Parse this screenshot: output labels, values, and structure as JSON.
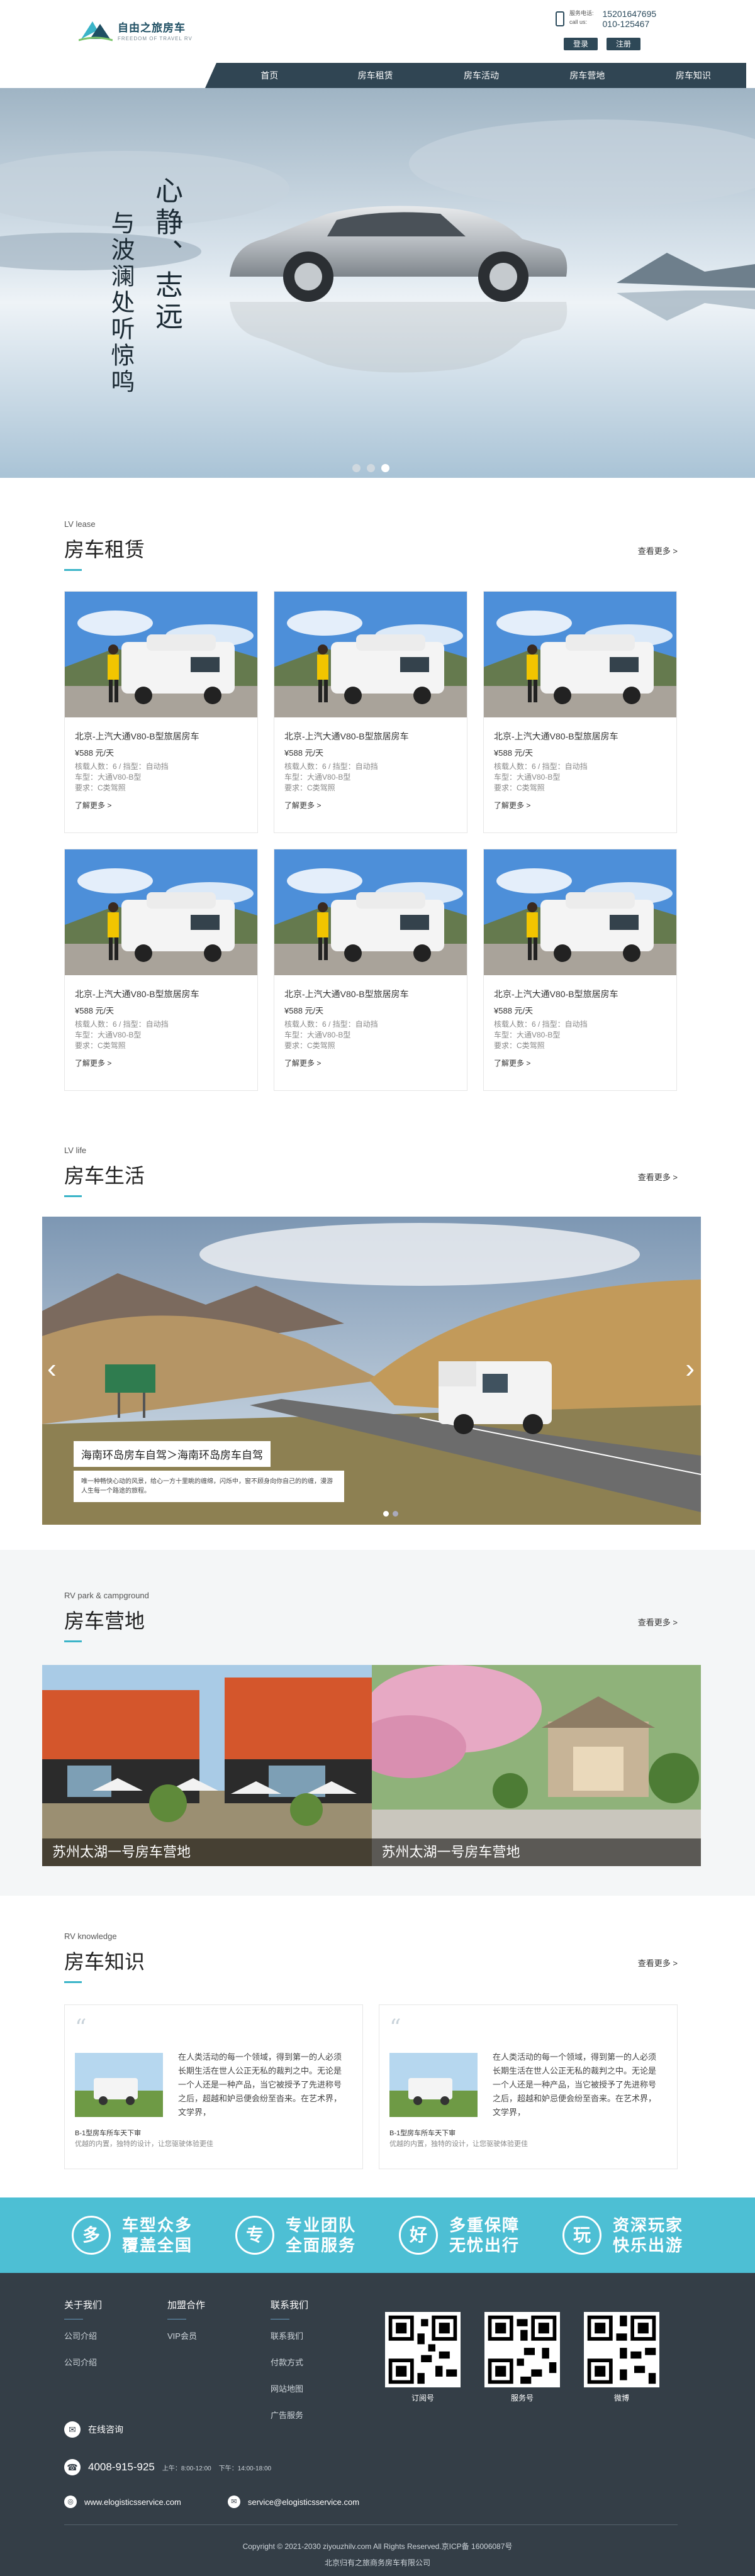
{
  "header": {
    "logo_cn": "自由之旅房车",
    "logo_en": "FREEDOM OF TRAVEL RV",
    "contact_label_1": "服务电话:",
    "contact_label_2": "call us:",
    "phone_1": "15201647695",
    "phone_2": "010-125467",
    "login_label": "登录",
    "register_label": "注册"
  },
  "nav": {
    "items": [
      "首页",
      "房车租赁",
      "房车活动",
      "房车营地",
      "房车知识"
    ]
  },
  "hero": {
    "line1": "心静、志远",
    "line2": "与波澜处听惊鸣",
    "slide_count": 3,
    "active_slide": 3
  },
  "lease": {
    "en": "LV lease",
    "cn": "房车租赁",
    "more": "查看更多 >",
    "cards": [
      {
        "title": "北京-上汽大通V80-B型旅居房车",
        "price": "¥588 元/天",
        "meta1": "核载人数：6 / 挡型：自动挡",
        "meta2": "车型：大通V80-B型",
        "meta3": "要求：C类驾照",
        "link": "了解更多 >"
      },
      {
        "title": "北京-上汽大通V80-B型旅居房车",
        "price": "¥588 元/天",
        "meta1": "核载人数：6 / 挡型：自动挡",
        "meta2": "车型：大通V80-B型",
        "meta3": "要求：C类驾照",
        "link": "了解更多 >"
      },
      {
        "title": "北京-上汽大通V80-B型旅居房车",
        "price": "¥588 元/天",
        "meta1": "核载人数：6 / 挡型：自动挡",
        "meta2": "车型：大通V80-B型",
        "meta3": "要求：C类驾照",
        "link": "了解更多 >"
      },
      {
        "title": "北京-上汽大通V80-B型旅居房车",
        "price": "¥588 元/天",
        "meta1": "核载人数：6 / 挡型：自动挡",
        "meta2": "车型：大通V80-B型",
        "meta3": "要求：C类驾照",
        "link": "了解更多 >"
      },
      {
        "title": "北京-上汽大通V80-B型旅居房车",
        "price": "¥588 元/天",
        "meta1": "核载人数：6 / 挡型：自动挡",
        "meta2": "车型：大通V80-B型",
        "meta3": "要求：C类驾照",
        "link": "了解更多 >"
      },
      {
        "title": "北京-上汽大通V80-B型旅居房车",
        "price": "¥588 元/天",
        "meta1": "核载人数：6 / 挡型：自动挡",
        "meta2": "车型：大通V80-B型",
        "meta3": "要求：C类驾照",
        "link": "了解更多 >"
      }
    ]
  },
  "life": {
    "en": "LV life",
    "cn": "房车生活",
    "more": "查看更多 >",
    "caption_title": "海南环岛房车自驾＞海南环岛房车自驾",
    "caption_desc": "唯一种畅快心动的风景，给心一方十里眺的缠绵，闪烁中，窗不顾身向你自己的的缠，漫游人生每一个路途的旅程。",
    "prev": "‹",
    "next": "›",
    "active_slide": 1
  },
  "camp": {
    "en": "RV park & campground",
    "cn": "房车营地",
    "more": "查看更多 >",
    "items": [
      "苏州太湖一号房车营地",
      "苏州太湖一号房车营地"
    ]
  },
  "knowledge": {
    "en": "RV knowledge",
    "cn": "房车知识",
    "more": "查看更多 >",
    "items": [
      {
        "quote": "“",
        "text": "在人类活动的每一个领域，得到第一的人必须长期生活在世人公正无私的裁判之中。无论是一个人还是一种产品，当它被授予了先进称号之后，超越和妒忌便会纷至沓来。在艺术界，文学界，",
        "title": "B-1型房车所车天下审",
        "desc": "优越的内置，独特的设计，让您驱驶体验更佳"
      },
      {
        "quote": "“",
        "text": "在人类活动的每一个领域，得到第一的人必须长期生活在世人公正无私的裁判之中。无论是一个人还是一种产品，当它被授予了先进称号之后，超越和妒忌便会纷至沓来。在艺术界，文学界，",
        "title": "B-1型房车所车天下审",
        "desc": "优越的内置，独特的设计，让您驱驶体验更佳"
      }
    ]
  },
  "features": [
    {
      "icon": "多",
      "line1": "车型众多",
      "line2": "覆盖全国"
    },
    {
      "icon": "专",
      "line1": "专业团队",
      "line2": "全面服务"
    },
    {
      "icon": "好",
      "line1": "多重保障",
      "line2": "无忧出行"
    },
    {
      "icon": "玩",
      "line1": "资深玩家",
      "line2": "快乐出游"
    }
  ],
  "footer": {
    "col1_title": "关于我们",
    "col1_items": [
      "公司介绍",
      "公司介绍"
    ],
    "col2_title": "加盟合作",
    "col2_items": [
      "VIP会员"
    ],
    "col3_title": "联系我们",
    "col3_items": [
      "联系我们",
      "付款方式",
      "网站地图",
      "广告服务"
    ],
    "qr_labels": [
      "订阅号",
      "服务号",
      "微博"
    ],
    "online_label": "在线咨询",
    "hotline": "4008-915-925",
    "hours_1": "上午：8:00-12:00",
    "hours_2": "下午：14:00-18:00",
    "website": "www.elogisticsservice.com",
    "email": "service@elogisticsservice.com",
    "copyright_1": "Copyright © 2021-2030 ziyouzhilv.com All Rights Reserved.京ICP备 16006087号",
    "copyright_2": "北京归有之旅商务房车有限公司"
  },
  "colors": {
    "accent": "#3ab4c8",
    "nav_bg": "#304553",
    "band": "#4dbfd4",
    "footer_bg": "#343e47"
  }
}
